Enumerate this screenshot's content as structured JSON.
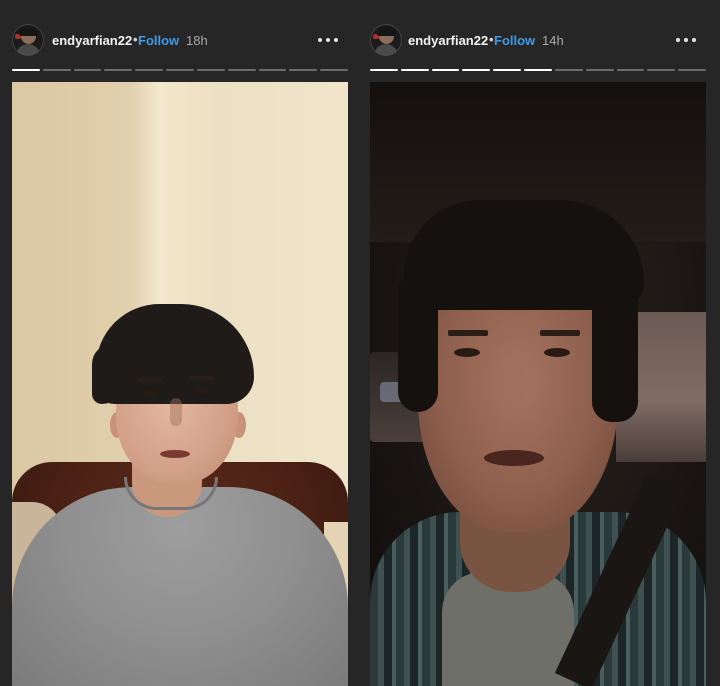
{
  "stories": [
    {
      "username": "endyarfian22",
      "separator": "•",
      "follow_label": "Follow",
      "time": "18h",
      "more_icon": "more-horizontal-icon",
      "segments_total": 11,
      "segments_done": 1
    },
    {
      "username": "endyarfian22",
      "separator": "•",
      "follow_label": "Follow",
      "time": "14h",
      "more_icon": "more-horizontal-icon",
      "segments_total": 11,
      "segments_done": 6
    }
  ],
  "colors": {
    "background": "#262626",
    "follow": "#3d9be9",
    "username": "#f2f2f2",
    "time": "#a8a8a8",
    "progress_done": "#ffffff",
    "progress_pending": "#6b6b6b"
  }
}
